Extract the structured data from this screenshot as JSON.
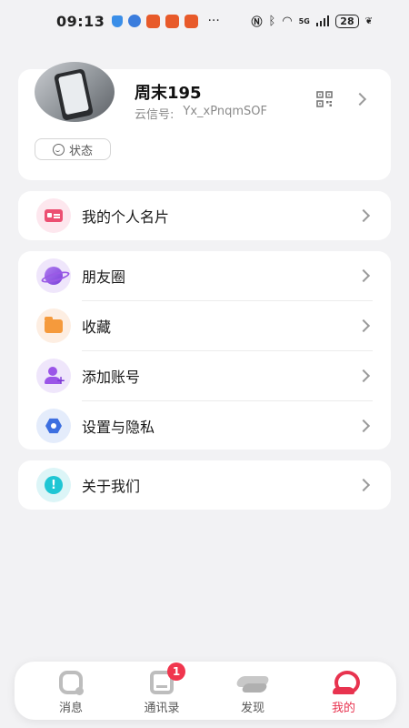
{
  "status_bar": {
    "time": "09:13",
    "dots": "···",
    "network": "5G",
    "battery": "28"
  },
  "profile": {
    "name": "周末195",
    "id_label": "云信号:",
    "id_value": "Yx_xPnqmSOF",
    "status_label": "状态"
  },
  "menu": {
    "namecard": "我的个人名片",
    "moments": "朋友圈",
    "favorites": "收藏",
    "add_account": "添加账号",
    "settings": "设置与隐私",
    "about": "关于我们"
  },
  "tabbar": {
    "messages": "消息",
    "contacts": "通讯录",
    "contacts_badge": "1",
    "discover": "发现",
    "me": "我的"
  },
  "colors": {
    "accent": "#e8334f",
    "background": "#f2f2f4"
  }
}
